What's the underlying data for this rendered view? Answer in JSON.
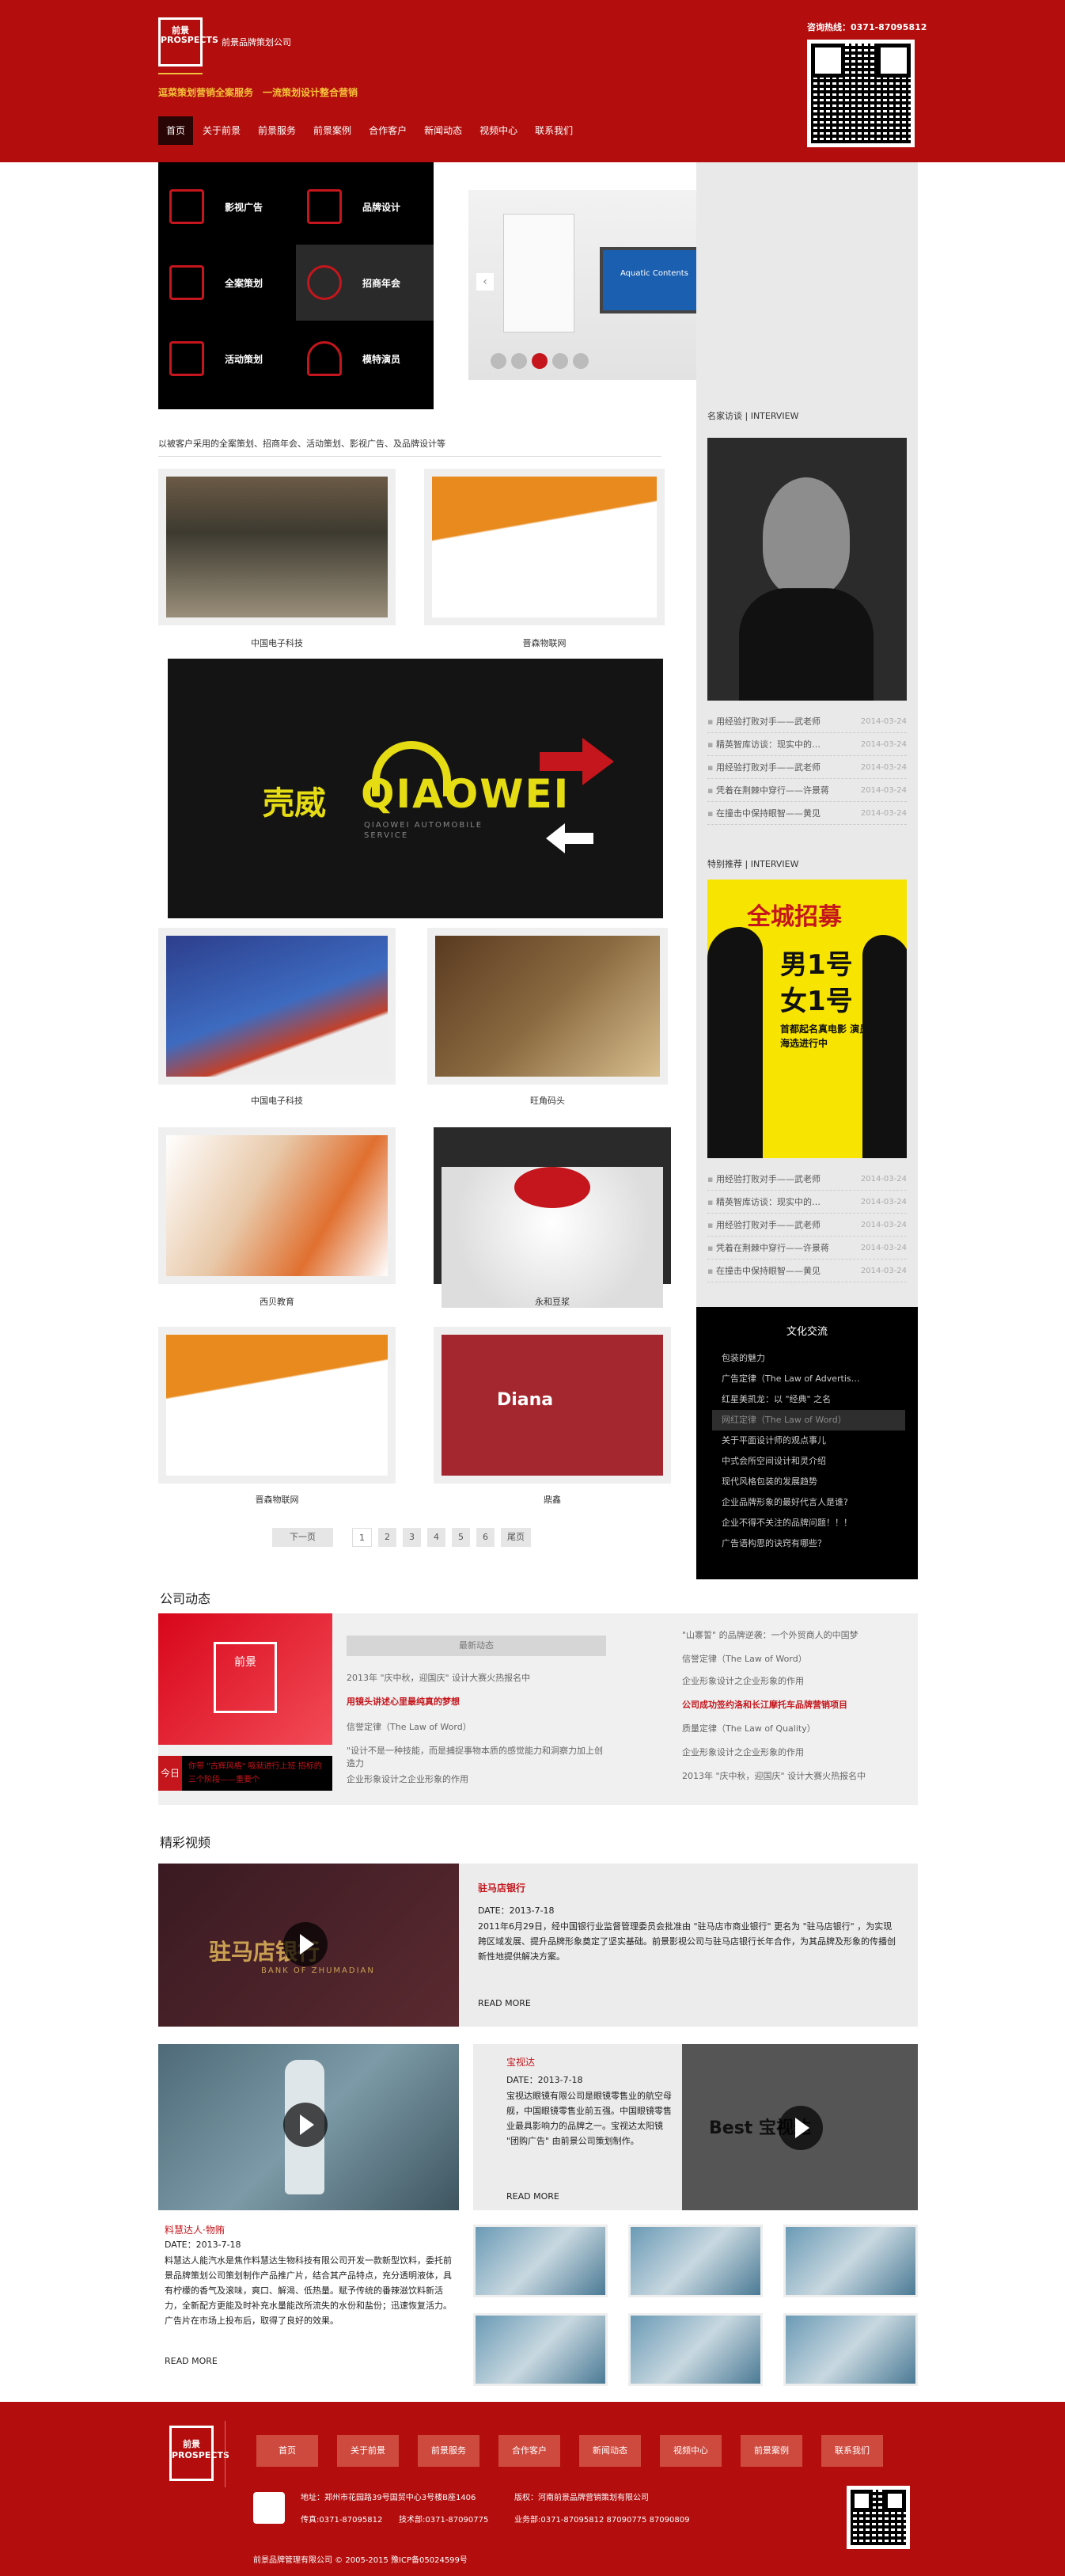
{
  "header": {
    "logo_text": "前景 PROSPECTS",
    "brand_name": "前景品牌策划公司",
    "slogan": "逗菜策划营销全案服务　一流策划设计整合营销",
    "hotline": "咨询热线：0371-87095812",
    "nav": [
      "首页",
      "关于前景",
      "前景服务",
      "前景案例",
      "合作客户",
      "新闻动态",
      "视频中心",
      "联系我们"
    ]
  },
  "services": [
    {
      "label": "影视广告",
      "icon": "film-icon"
    },
    {
      "label": "品牌设计",
      "icon": "brush-icon"
    },
    {
      "label": "全案策划",
      "icon": "document-icon"
    },
    {
      "label": "招商年会",
      "icon": "globe-icon"
    },
    {
      "label": "活动策划",
      "icon": "flag-icon"
    },
    {
      "label": "模特演员",
      "icon": "person-icon"
    }
  ],
  "banner": {
    "screen_title": "Aquatic Contents",
    "active_slide": 3,
    "slides": 5
  },
  "intro": "以被客户采用的全案策划、招商年会、活动策划、影视广告、及品牌设计等",
  "cases": [
    {
      "caption": "中国电子科技"
    },
    {
      "caption": "晋森物联网"
    },
    {
      "caption": "中国电子科技"
    },
    {
      "caption": "旺角码头"
    },
    {
      "caption": "西贝教育"
    },
    {
      "caption": "永和豆浆"
    },
    {
      "caption": "晋森物联网"
    },
    {
      "caption": "鼎鑫"
    }
  ],
  "bigad": {
    "cn": "壳威",
    "en": "QIAOWEI",
    "sub": "QIAOWEI AUTOMOBILE SERVICE"
  },
  "pager": [
    "下一页",
    "1",
    "2",
    "3",
    "4",
    "5",
    "6",
    "尾页"
  ],
  "side": {
    "interview_title": "名家访谈 | INTERVIEW",
    "interview_list": [
      {
        "t": "用经验打败对手——武老师",
        "d": "2014-03-24"
      },
      {
        "t": "精英智库访谈：现实中的…",
        "d": "2014-03-24"
      },
      {
        "t": "用经验打败对手——武老师",
        "d": "2014-03-24"
      },
      {
        "t": "凭着在荆棘中穿行——许景蒋",
        "d": "2014-03-24"
      },
      {
        "t": "在撞击中保持眼智——黄见",
        "d": "2014-03-24"
      }
    ],
    "special_title": "特别推荐 | INTERVIEW",
    "poster": {
      "head": "全城招募",
      "line1": "男1号",
      "line2": "女1号",
      "sub": "首都起名真电影 演员海选进行中"
    },
    "special_list": [
      {
        "t": "用经验打败对手——武老师",
        "d": "2014-03-24"
      },
      {
        "t": "精英智库访谈：现实中的…",
        "d": "2014-03-24"
      },
      {
        "t": "用经验打败对手——武老师",
        "d": "2014-03-24"
      },
      {
        "t": "凭着在荆棘中穿行——许景蒋",
        "d": "2014-03-24"
      },
      {
        "t": "在撞击中保持眼智——黄见",
        "d": "2014-03-24"
      }
    ],
    "culture_title": "文化交流",
    "culture_list": [
      "包装的魅力",
      "广告定律（The Law of Advertis…",
      "红星美凯龙：以 \"经典\" 之名",
      "网红定律（The Law of Word）",
      "关于平面设计师的观点事儿",
      "中式会所空间设计和灵介绍",
      "现代风格包装的发展趋势",
      "企业品牌形象的最好代言人是谁?",
      "企业不得不关注的品牌问题！！！",
      "广告语构思的诀窍有哪些？"
    ],
    "culture_active": 3
  },
  "news": {
    "section_title": "公司动态",
    "logo": "前景",
    "ticker_label": "今日",
    "ticker_text": "你带 \"古辉风格\" 吸就进行上班 招标的三个阶段——重要个",
    "head": "最新动态",
    "left_list": [
      {
        "t": "2013年 \"庆中秋，迎国庆\" 设计大赛火热报名中",
        "red": false
      },
      {
        "t": "用镜头讲述心里最纯真的梦想",
        "red": true
      },
      {
        "t": "信誉定律（The Law of Word）",
        "red": false
      },
      {
        "t": "\"设计不是一种技能，而是捕捉事物本质的感觉能力和洞察力加上创造力",
        "red": false
      },
      {
        "t": "企业形象设计之企业形象的作用",
        "red": false
      }
    ],
    "right_list": [
      {
        "t": "\"山寨誓\" 的品牌逆袭：一个外贸商人的中国梦",
        "red": false
      },
      {
        "t": "信誉定律（The Law of Word）",
        "red": false
      },
      {
        "t": "企业形象设计之企业形象的作用",
        "red": false
      },
      {
        "t": "公司成功签约洛和长江摩托车品牌营销项目",
        "red": true
      },
      {
        "t": "质量定律（The Law of Quality）",
        "red": false
      },
      {
        "t": "企业形象设计之企业形象的作用",
        "red": false
      },
      {
        "t": "2013年 \"庆中秋，迎国庆\" 设计大赛火热报名中",
        "red": false
      }
    ]
  },
  "videos": {
    "section_title": "精彩视频",
    "main": {
      "title": "驻马店银行",
      "date": "DATE：2013-7-18",
      "text": "2011年6月29日，经中国银行业监督管理委员会批准由 \"驻马店市商业银行\" 更名为 \"驻马店银行\" ，为实现跨区域发展、提升品牌形象奠定了坚实基础。前景影视公司与驻马店银行长年合作，为其品牌及形象的传播创新性地提供解决方案。",
      "more": "READ MORE",
      "logo_cn": "驻马店银行",
      "logo_en": "BANK OF ZHUMADIAN"
    },
    "second": {
      "title": "宝视达",
      "date": "DATE：2013-7-18",
      "text": "宝视达眼镜有限公司是眼镜零售业的航空母舰，中国眼镜零售业前五强。中国眼镜零售业最具影响力的品牌之一。宝视达太阳镜 \"团购广告\" 由前景公司策划制作。",
      "more": "READ MORE",
      "logo": "Best 宝视达"
    },
    "third": {
      "title": "料慧达人·物贿",
      "date": "DATE：2013-7-18",
      "text": "料慧达人能汽水是焦作料慧达生物科技有限公司开发一款新型饮料，委托前景品牌策划公司策划制作产品推广片，结合其产品特点，充分透明液体，具有柠檬的香气及滚味，爽口、解渴、低热量。赋予传统的番辣滋饮料新活力，全新配方更能及时补充水量能改所流失的水份和盐份；迅速恢复活力。广告片在市场上投布后，取得了良好的效果。",
      "more": "READ MORE"
    },
    "thumbs": 6
  },
  "footer": {
    "logo": "前景 PROSPECTS",
    "nav": [
      "首页",
      "关于前景",
      "前景服务",
      "合作客户",
      "新闻动态",
      "视频中心",
      "前景案例",
      "联系我们"
    ],
    "address": "地址：郑州市花园路39号国贸中心3号楼B座1406",
    "copyright_owner": "版权：河南前景品牌营销策划有限公司",
    "fax": "传真:0371-87095812",
    "tech": "技术部:0371-87090775",
    "biz": "业务部:0371-87095812 87090775 87090809",
    "copy": "前景品牌管理有限公司 © 2005-2015 豫ICP备05024599号"
  }
}
